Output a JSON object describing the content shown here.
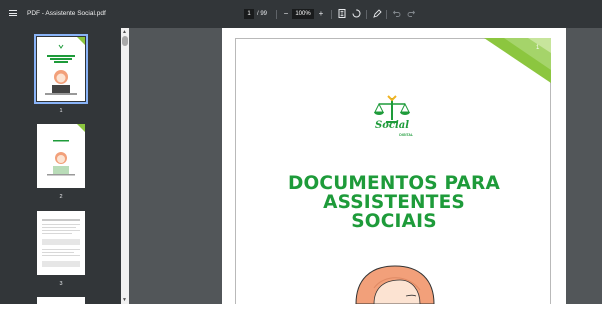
{
  "toolbar": {
    "title": "PDF - Assistente Social.pdf",
    "current_page": "1",
    "page_total": "/ 99",
    "zoom": "100%",
    "menu_icon": "menu-icon",
    "zoom_out_icon": "minus-icon",
    "zoom_in_icon": "plus-icon",
    "fit_icon": "fit-page-icon",
    "rotate_icon": "rotate-icon",
    "annotate_icon": "pen-icon",
    "undo_icon": "undo-icon",
    "redo_icon": "redo-icon"
  },
  "sidebar": {
    "thumbnails": [
      {
        "label": "1",
        "selected": true
      },
      {
        "label": "2",
        "selected": false
      },
      {
        "label": "3",
        "selected": false
      }
    ]
  },
  "document": {
    "page_number": "1",
    "logo_text": "Social",
    "logo_subtext": "DIGITAL",
    "heading_lines": [
      "DOCUMENTOS PARA",
      "ASSISTENTES",
      "SOCIAIS"
    ],
    "accent_color": "#1e9b3a",
    "corner_color": "#8cc63f"
  }
}
